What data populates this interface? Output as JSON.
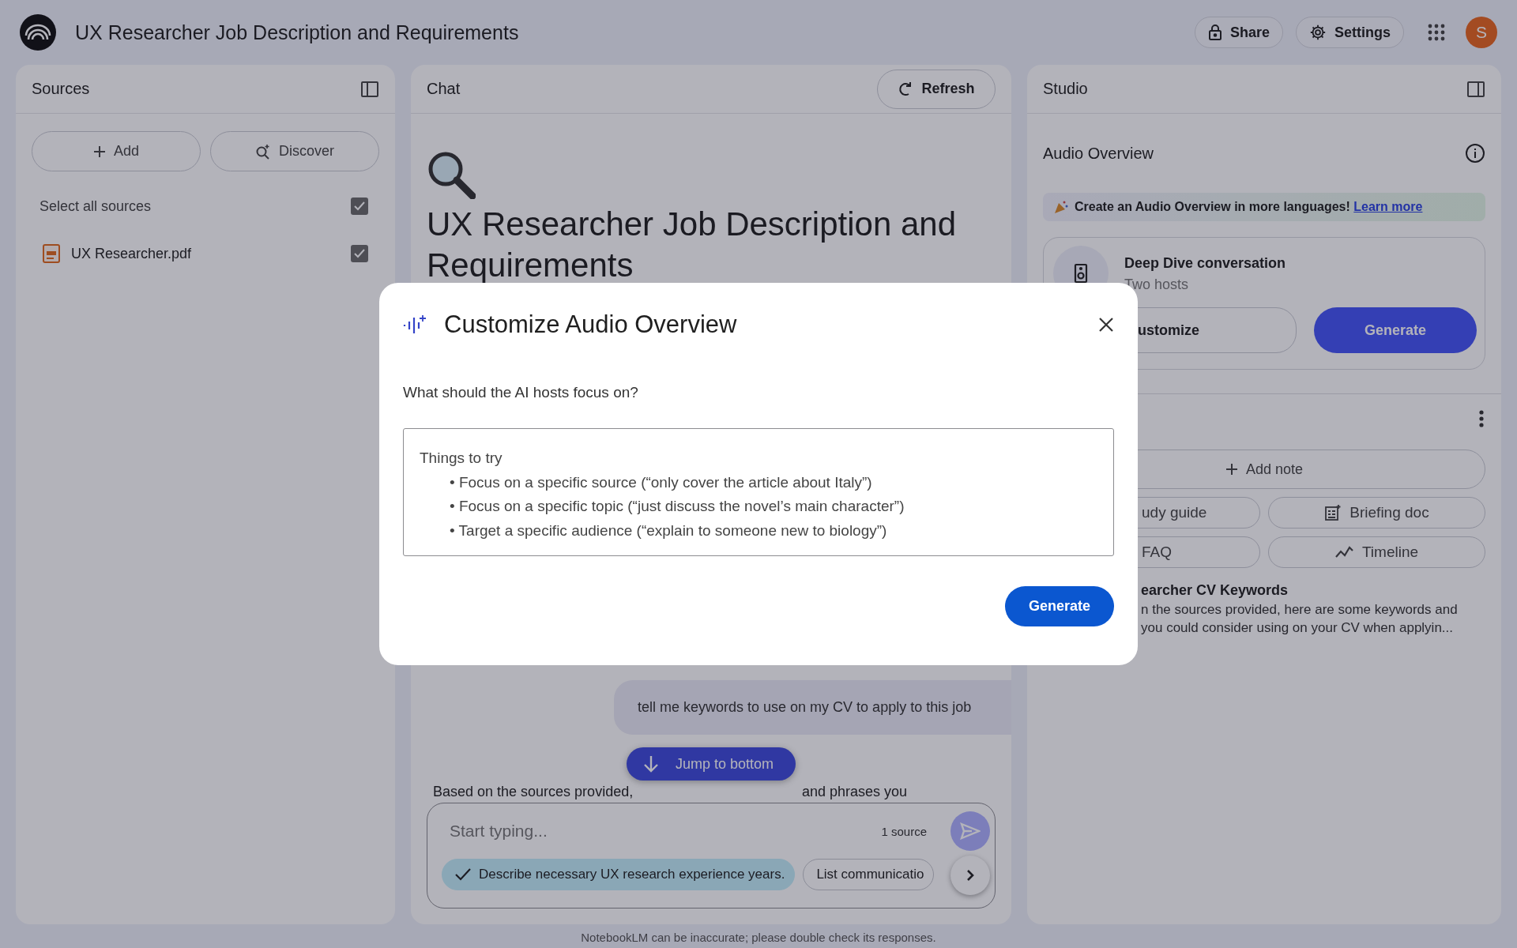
{
  "app": {
    "title": "UX Researcher Job Description and Requirements",
    "actions": [
      {
        "kind": "share",
        "label": "Share"
      },
      {
        "kind": "settings",
        "label": "Settings"
      }
    ],
    "avatar": "S"
  },
  "sources": {
    "title": "Sources",
    "add": "Add",
    "discover": "Discover",
    "select_all": {
      "label": "Select all sources",
      "checked": true
    },
    "items": [
      {
        "name": "UX Researcher.pdf",
        "checked": true
      }
    ]
  },
  "chat": {
    "title": "Chat",
    "refresh": "Refresh",
    "notebook_title": "UX Researcher Job Description and Requirements",
    "user_message": "tell me keywords to use on my CV to apply to this job",
    "response_start": "Based on the sources provided,",
    "response_end": "and phrases you",
    "jump": "Jump to bottom",
    "input": {
      "placeholder": "Start typing...",
      "source_count": "1 source"
    },
    "suggestions": [
      {
        "text": "Describe necessary UX research experience years.",
        "selected": true
      },
      {
        "text": "List communicatio",
        "selected": false
      }
    ]
  },
  "studio": {
    "title": "Studio",
    "audio_overview": "Audio Overview",
    "banner": {
      "text": "Create an Audio Overview in more languages!",
      "link": "Learn more"
    },
    "deep_dive": {
      "title": "Deep Dive conversation",
      "subtitle": "Two hosts",
      "customize": "ustomize",
      "generate": "Generate"
    },
    "add_note": "Add note",
    "tools": [
      {
        "kind": "text",
        "label": "udy guide"
      },
      {
        "kind": "briefing",
        "label": "Briefing doc"
      },
      {
        "kind": "text",
        "label": "FAQ"
      },
      {
        "kind": "timeline",
        "label": "Timeline"
      }
    ],
    "note": {
      "title": "earcher CV Keywords",
      "lines": [
        "n the sources provided, here are some keywords and",
        "you could consider using on your CV when applyin..."
      ]
    }
  },
  "dialog": {
    "title": "Customize Audio Overview",
    "question": "What should the AI hosts focus on?",
    "placeholder_title": "Things to try",
    "placeholder_items": [
      "• Focus on a specific source (“only cover the article about Italy”)",
      "• Focus on a specific topic (“just discuss the novel’s main character”)",
      "• Target a specific audience (“explain to someone new to biology”)"
    ],
    "generate": "Generate"
  },
  "footer": "NotebookLM can be inaccurate; please double check its responses."
}
